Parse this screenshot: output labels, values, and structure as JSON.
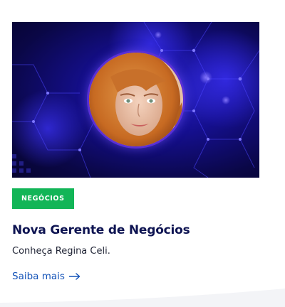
{
  "card": {
    "category": "NEGÓCIOS",
    "title": "Nova Gerente de Negócios",
    "excerpt": "Conheça Regina Celi.",
    "read_more_label": "Saiba mais",
    "read_more_icon": "arrow-right-icon"
  },
  "colors": {
    "badge_bg": "#12b557",
    "title": "#0e1452",
    "link": "#1453b8",
    "hero_bg": "#0a0746",
    "portrait_ring": "#5a2fd6"
  }
}
